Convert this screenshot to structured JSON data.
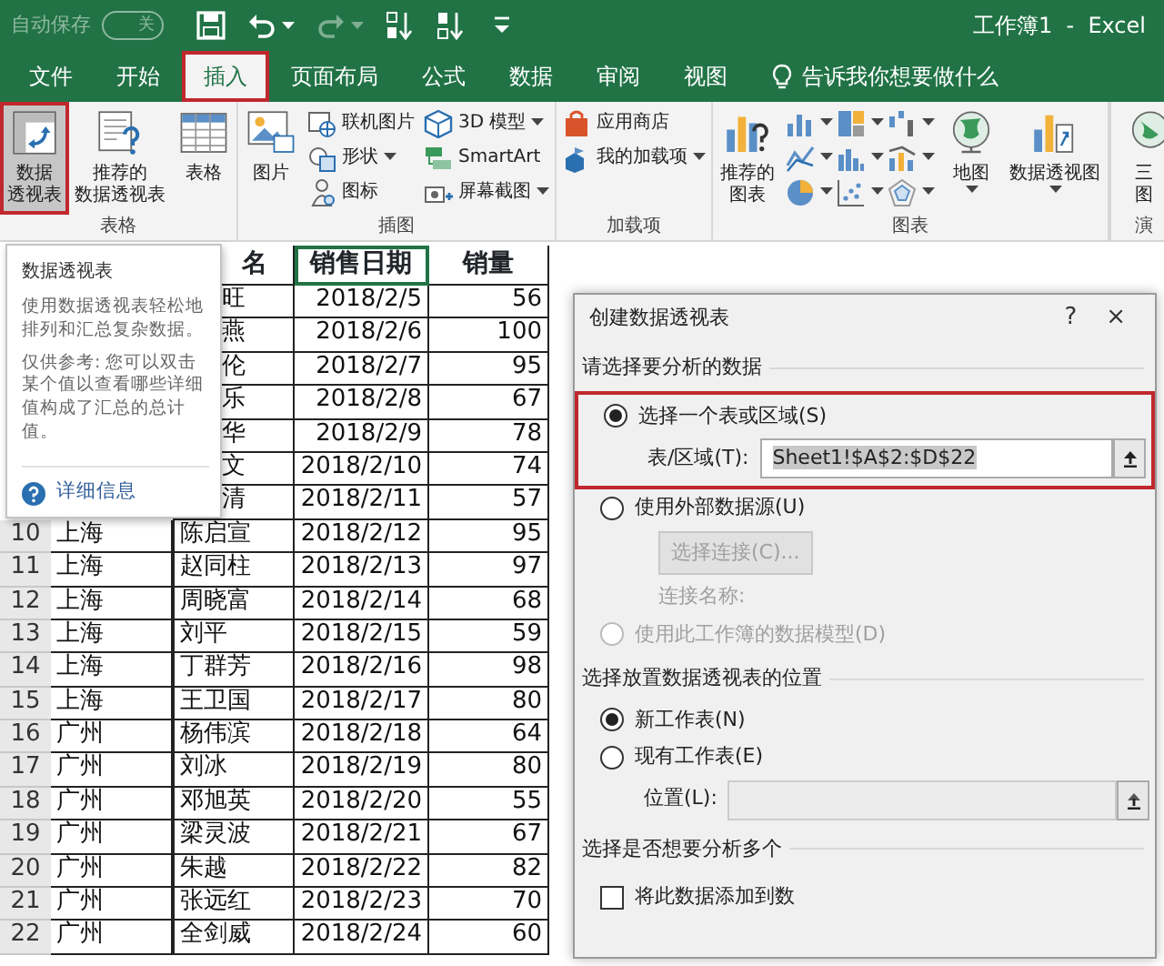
{
  "title_bar": {
    "autosave": {
      "label": "自动保存",
      "state_text": "关",
      "on": false
    },
    "title": "工作簿1  -  Excel"
  },
  "tabs": [
    {
      "label": "文件",
      "selected": false,
      "highlighted": false
    },
    {
      "label": "开始",
      "selected": false,
      "highlighted": false
    },
    {
      "label": "插入",
      "selected": true,
      "highlighted": true
    },
    {
      "label": "页面布局",
      "selected": false,
      "highlighted": false
    },
    {
      "label": "公式",
      "selected": false,
      "highlighted": false
    },
    {
      "label": "数据",
      "selected": false,
      "highlighted": false
    },
    {
      "label": "审阅",
      "selected": false,
      "highlighted": false
    },
    {
      "label": "视图",
      "selected": false,
      "highlighted": false
    }
  ],
  "tell_me": {
    "placeholder": "告诉我你想要做什么"
  },
  "ribbon_groups": [
    {
      "label": "表格",
      "items": [
        {
          "kind": "large",
          "lines": [
            "数据",
            "透视表"
          ],
          "pressed": true,
          "highlighted": true,
          "dropdown": false
        },
        {
          "kind": "large",
          "lines": [
            "推荐的",
            "数据透视表"
          ],
          "pressed": false,
          "highlighted": false,
          "dropdown": false
        },
        {
          "kind": "large",
          "lines": [
            "表格"
          ],
          "pressed": false,
          "highlighted": false,
          "dropdown": false
        }
      ]
    },
    {
      "label": "插图",
      "items": [
        {
          "kind": "large",
          "lines": [
            "图片"
          ],
          "pressed": false,
          "highlighted": false,
          "dropdown": false
        },
        {
          "kind": "column",
          "items": [
            {
              "label": "联机图片",
              "dropdown": false
            },
            {
              "label": "形状",
              "dropdown": true
            },
            {
              "label": "图标",
              "dropdown": false
            }
          ]
        },
        {
          "kind": "column",
          "items": [
            {
              "label": "3D 模型",
              "dropdown": true
            },
            {
              "label": "SmartArt",
              "dropdown": false
            },
            {
              "label": "屏幕截图",
              "dropdown": true
            }
          ]
        }
      ]
    },
    {
      "label": "加载项",
      "items": [
        {
          "kind": "column",
          "items": [
            {
              "label": "应用商店",
              "dropdown": false
            },
            {
              "label": "我的加载项",
              "dropdown": true
            }
          ]
        }
      ]
    },
    {
      "label": "图表",
      "items": [
        {
          "kind": "large",
          "lines": [
            "推荐的",
            "图表"
          ],
          "pressed": false,
          "highlighted": false,
          "dropdown": false
        },
        {
          "kind": "gallery"
        },
        {
          "kind": "large",
          "lines": [
            "地图"
          ],
          "pressed": false,
          "highlighted": false,
          "dropdown": true
        },
        {
          "kind": "large",
          "lines": [
            "数据透视图"
          ],
          "pressed": false,
          "highlighted": false,
          "dropdown": true
        }
      ]
    },
    {
      "label": "演",
      "items": [
        {
          "kind": "large",
          "lines": [
            "三",
            "图"
          ],
          "pressed": false,
          "highlighted": false,
          "dropdown": false
        }
      ]
    }
  ],
  "sheet": {
    "header": {
      "covered": true,
      "cells": [
        {
          "text": "名",
          "selected": false
        },
        {
          "text": "销售日期",
          "selected": true
        },
        {
          "text": "销量",
          "selected": false
        }
      ]
    },
    "rows": [
      {
        "covered": true,
        "name": "旺",
        "date": "2018/2/5",
        "sales": "56"
      },
      {
        "covered": true,
        "name": "燕",
        "date": "2018/2/6",
        "sales": "100"
      },
      {
        "covered": true,
        "name": "伦",
        "date": "2018/2/7",
        "sales": "95"
      },
      {
        "covered": true,
        "name": "乐",
        "date": "2018/2/8",
        "sales": "67"
      },
      {
        "covered": true,
        "name": "华",
        "date": "2018/2/9",
        "sales": "78"
      },
      {
        "covered": true,
        "name": "文",
        "date": "2018/2/10",
        "sales": "74"
      },
      {
        "covered": true,
        "name": "清",
        "date": "2018/2/11",
        "sales": "57"
      },
      {
        "covered": false,
        "number": "10",
        "region": "上海",
        "name": "陈启宣",
        "date": "2018/2/12",
        "sales": "95"
      },
      {
        "covered": false,
        "number": "11",
        "region": "上海",
        "name": "赵同柱",
        "date": "2018/2/13",
        "sales": "97"
      },
      {
        "covered": false,
        "number": "12",
        "region": "上海",
        "name": "周晓富",
        "date": "2018/2/14",
        "sales": "68"
      },
      {
        "covered": false,
        "number": "13",
        "region": "上海",
        "name": "刘平",
        "date": "2018/2/15",
        "sales": "59"
      },
      {
        "covered": false,
        "number": "14",
        "region": "上海",
        "name": "丁群芳",
        "date": "2018/2/16",
        "sales": "98"
      },
      {
        "covered": false,
        "number": "15",
        "region": "上海",
        "name": "王卫国",
        "date": "2018/2/17",
        "sales": "80"
      },
      {
        "covered": false,
        "number": "16",
        "region": "广州",
        "name": "杨伟滨",
        "date": "2018/2/18",
        "sales": "64"
      },
      {
        "covered": false,
        "number": "17",
        "region": "广州",
        "name": "刘冰",
        "date": "2018/2/19",
        "sales": "80"
      },
      {
        "covered": false,
        "number": "18",
        "region": "广州",
        "name": "邓旭英",
        "date": "2018/2/20",
        "sales": "55"
      },
      {
        "covered": false,
        "number": "19",
        "region": "广州",
        "name": "梁灵波",
        "date": "2018/2/21",
        "sales": "67"
      },
      {
        "covered": false,
        "number": "20",
        "region": "广州",
        "name": "朱越",
        "date": "2018/2/22",
        "sales": "82"
      },
      {
        "covered": false,
        "number": "21",
        "region": "广州",
        "name": "张远红",
        "date": "2018/2/23",
        "sales": "70"
      },
      {
        "covered": false,
        "number": "22",
        "region": "广州",
        "name": "全剑威",
        "date": "2018/2/24",
        "sales": "60"
      }
    ]
  },
  "tooltip": {
    "title": "数据透视表",
    "paragraphs": [
      "使用数据透视表轻松地排列和汇总复杂数据。",
      "仅供参考: 您可以双击某个值以查看哪些详细值构成了汇总的总计值。"
    ],
    "link": "详细信息"
  },
  "dialog": {
    "title": "创建数据透视表",
    "help": "?",
    "close": "×",
    "rows": [
      {
        "kind": "section",
        "text": "请选择要分析的数据"
      },
      {
        "kind": "highlight",
        "rows": [
          {
            "kind": "radio",
            "label": "选择一个表或区域(S)",
            "selected": true,
            "disabled": false
          },
          {
            "kind": "field",
            "label": "表/区域(T):",
            "value": "Sheet1!$A$2:$D$22",
            "text_selected": true,
            "disabled": false
          }
        ]
      },
      {
        "kind": "radio",
        "label": "使用外部数据源(U)",
        "selected": false,
        "disabled": false
      },
      {
        "kind": "button",
        "label": "选择连接(C)...",
        "disabled": true
      },
      {
        "kind": "label",
        "text": "连接名称:",
        "disabled": true
      },
      {
        "kind": "radio",
        "label": "使用此工作簿的数据模型(D)",
        "selected": false,
        "disabled": true
      },
      {
        "kind": "section",
        "text": "选择放置数据透视表的位置"
      },
      {
        "kind": "radio",
        "label": "新工作表(N)",
        "selected": true,
        "disabled": false
      },
      {
        "kind": "radio",
        "label": "现有工作表(E)",
        "selected": false,
        "disabled": false
      },
      {
        "kind": "field",
        "label": "位置(L):",
        "disabled": true
      },
      {
        "kind": "section",
        "text": "选择是否想要分析多个"
      },
      {
        "kind": "checkbox",
        "label": "将此数据添加到数",
        "checked": false
      }
    ]
  }
}
